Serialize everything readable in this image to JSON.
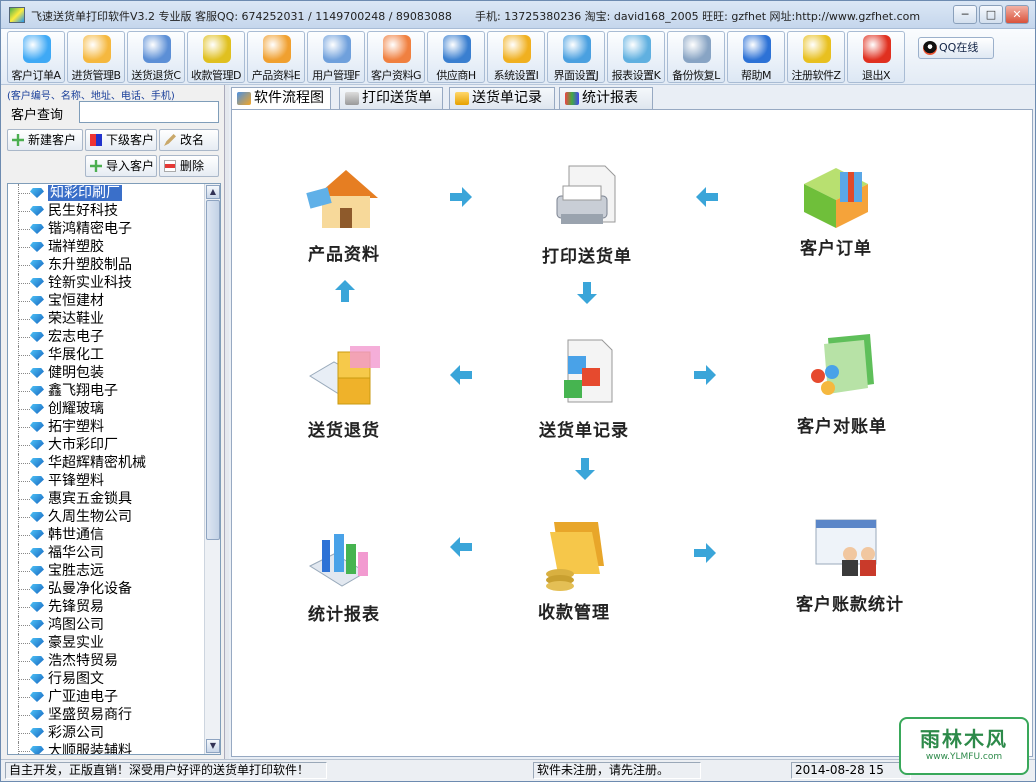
{
  "window": {
    "title": "飞速送货单打印软件V3.2 专业版 客服QQ: 674252031 / 1149700248 / 89083088",
    "contact": "手机: 13725380236 淘宝: david168_2005 旺旺: gzfhet   网址:http://www.gzfhet.com",
    "min": "─",
    "max": "□",
    "close": "✕"
  },
  "toolbar": [
    {
      "label": "客户订单A",
      "icon": "order-icon",
      "color": "#3fa9f5"
    },
    {
      "label": "进货管理B",
      "icon": "purchase-icon",
      "color": "#f5b83f"
    },
    {
      "label": "送货退货C",
      "icon": "return-icon",
      "color": "#5c8fd6"
    },
    {
      "label": "收款管理D",
      "icon": "money-icon",
      "color": "#e0c020"
    },
    {
      "label": "产品资料E",
      "icon": "product-icon",
      "color": "#f0a030"
    },
    {
      "label": "用户管理F",
      "icon": "user-mgmt-icon",
      "color": "#6fa0dc"
    },
    {
      "label": "客户资料G",
      "icon": "customer-icon",
      "color": "#f08040"
    },
    {
      "label": "供应商H",
      "icon": "supplier-icon",
      "color": "#3a7fd0"
    },
    {
      "label": "系统设置I",
      "icon": "settings-icon",
      "color": "#f0b020"
    },
    {
      "label": "界面设置J",
      "icon": "monitor-icon",
      "color": "#4aa0e0"
    },
    {
      "label": "报表设置K",
      "icon": "report-icon",
      "color": "#60b0e0"
    },
    {
      "label": "备份恢复L",
      "icon": "backup-icon",
      "color": "#88a4c4"
    },
    {
      "label": "帮助M",
      "icon": "help-icon",
      "color": "#2d72d6"
    },
    {
      "label": "注册软件Z",
      "icon": "register-icon",
      "color": "#e8c020"
    },
    {
      "label": "退出X",
      "icon": "exit-icon",
      "color": "#e03020"
    }
  ],
  "qq_button": "QQ在线",
  "left": {
    "hint": "(客户编号、名称、地址、电话、手机)",
    "query_label": "客户查询",
    "query_value": "",
    "buttons": {
      "new": "新建客户",
      "sub": "下级客户",
      "rename": "改名",
      "import": "导入客户",
      "delete": "删除"
    },
    "customers": [
      "知彩印刷厂",
      "民生好科技",
      "锴鸿精密电子",
      "瑞祥塑胶",
      "东升塑胶制品",
      "铨新实业科技",
      "宝恒建材",
      "荣达鞋业",
      "宏志电子",
      "华展化工",
      "健明包装",
      "鑫飞翔电子",
      "创耀玻璃",
      "拓宇塑料",
      "大市彩印厂",
      "华超辉精密机械",
      "平锋塑料",
      "惠宾五金锁具",
      "久周生物公司",
      "韩世通信",
      "福华公司",
      "宝胜志远",
      "弘曼净化设备",
      "先锋贸易",
      "鸿图公司",
      "豪昱实业",
      "浩杰特贸易",
      "行易图文",
      "广亚迪电子",
      "坚盛贸易商行",
      "彩源公司",
      "大顺服装辅料"
    ]
  },
  "tabs": [
    "软件流程图",
    "打印送货单",
    "送货单记录",
    "统计报表"
  ],
  "flow": {
    "product": "产品资料",
    "print": "打印送货单",
    "order": "客户订单",
    "return": "送货退货",
    "record": "送货单记录",
    "statement": "客户对账单",
    "stats": "统计报表",
    "payment": "收款管理",
    "account": "客户账款统计"
  },
  "status": {
    "left": "自主开发，正版直销！深受用户好评的送货单打印软件！",
    "mid": "软件未注册，请先注册。",
    "right": "2014-08-28 15"
  },
  "watermark": {
    "line1": "雨林木风",
    "line2": "www.YLMFU.com"
  }
}
